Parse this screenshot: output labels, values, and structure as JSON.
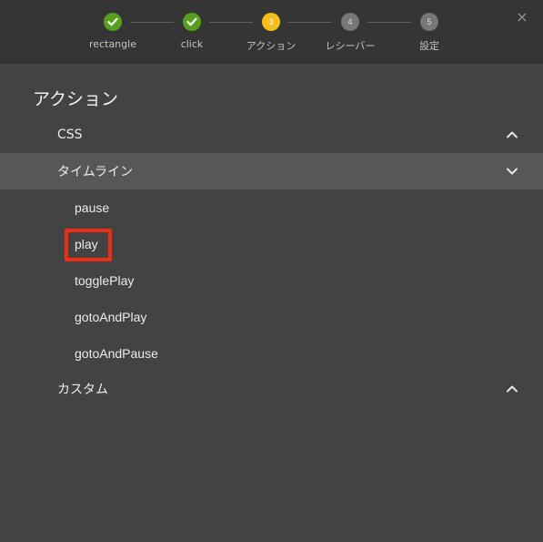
{
  "wizard": {
    "steps": [
      {
        "label": "rectangle",
        "status": "done",
        "marker": ""
      },
      {
        "label": "click",
        "status": "done",
        "marker": ""
      },
      {
        "label": "アクション",
        "status": "active",
        "marker": "3"
      },
      {
        "label": "レシーバー",
        "status": "pending",
        "marker": "4"
      },
      {
        "label": "設定",
        "status": "pending",
        "marker": "5"
      }
    ],
    "close_icon": "×"
  },
  "panel": {
    "title": "アクション",
    "sections": [
      {
        "label": "CSS",
        "expanded": false
      },
      {
        "label": "タイムライン",
        "expanded": true
      },
      {
        "label": "カスタム",
        "expanded": false
      }
    ],
    "timeline_items": [
      "pause",
      "play",
      "togglePlay",
      "gotoAndPlay",
      "gotoAndPause"
    ],
    "selected_item": "play"
  },
  "colors": {
    "background": "#434343",
    "header": "#353535",
    "highlight_row": "#575757",
    "done_step": "#57a01e",
    "active_step": "#f6be1a",
    "pending_step": "#777777",
    "selection_border": "#ef2d12"
  }
}
